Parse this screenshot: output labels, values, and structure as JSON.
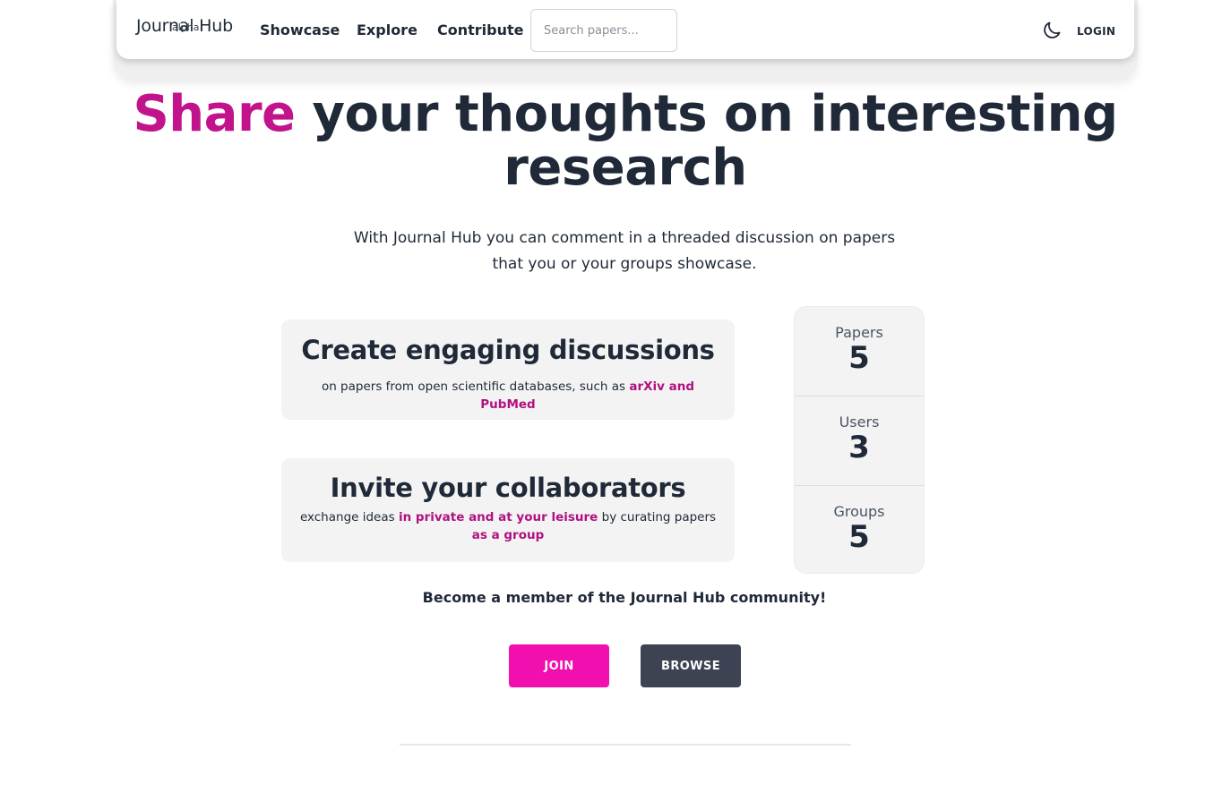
{
  "navbar": {
    "brand_name": "Journal Hub",
    "brand_tag": "alpha",
    "links": [
      "Showcase",
      "Explore",
      "Contribute"
    ],
    "search_placeholder": "Search papers...",
    "theme_icon": "moon-icon",
    "login_label": "LOGIN"
  },
  "hero": {
    "title_accent": "Share",
    "title_rest": " your thoughts on interesting research",
    "subtitle": "With Journal Hub you can comment in a threaded discussion on papers that you or your groups showcase."
  },
  "features": [
    {
      "title": "Create engaging discussions",
      "text_before": "on papers from open scientific databases, such as ",
      "highlight": "arXiv and PubMed"
    },
    {
      "title": "Invite your collaborators",
      "text_before": "exchange ideas ",
      "highlight_1": "in private and at your leisure",
      "text_middle": " by curating papers ",
      "highlight_2": "as a group"
    }
  ],
  "stats": [
    {
      "label": "Papers",
      "value": "5"
    },
    {
      "label": "Users",
      "value": "3"
    },
    {
      "label": "Groups",
      "value": "5"
    }
  ],
  "cta": {
    "text": "Become a member of the Journal Hub community!",
    "join_label": "JOIN",
    "browse_label": "BROWSE"
  },
  "colors": {
    "accent": "#c2138c",
    "join_button": "#f20fb0",
    "browse_button": "#3d4352",
    "card_background": "#f3f3f4"
  }
}
